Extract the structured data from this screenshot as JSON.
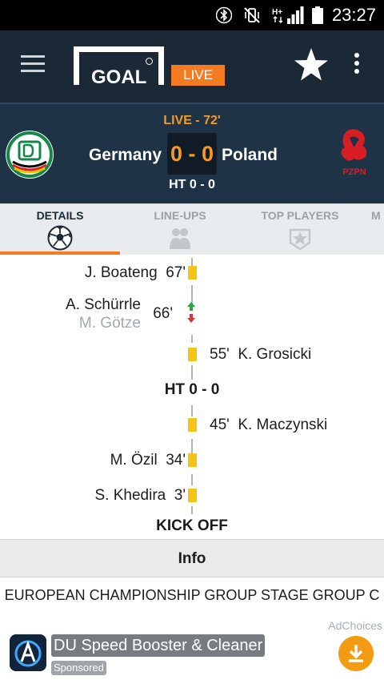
{
  "status_bar": {
    "time": "23:27",
    "icons": [
      "bluetooth-icon",
      "vibrate-icon",
      "hplus-network-icon",
      "signal-icon",
      "battery-icon"
    ]
  },
  "app_bar": {
    "logo_text": "GOAL",
    "live_badge": "LIVE",
    "icons": [
      "menu-icon",
      "star-icon",
      "more-vert-icon"
    ]
  },
  "match": {
    "status": "LIVE - 72'",
    "home_team": "Germany",
    "away_team": "Poland",
    "score": "0 - 0",
    "halftime": "HT 0 - 0",
    "away_crest_text": "PZPN"
  },
  "tabs": [
    {
      "label": "DETAILS",
      "icon": "soccer-ball-icon",
      "active": true
    },
    {
      "label": "LINE-UPS",
      "icon": "players-icon",
      "active": false
    },
    {
      "label": "TOP PLAYERS",
      "icon": "star-badge-icon",
      "active": false
    },
    {
      "label": "M",
      "icon": "",
      "active": false
    }
  ],
  "timeline": {
    "events": [
      {
        "side": "home",
        "type": "yellow-card",
        "player": "J. Boateng",
        "minute": "67'"
      },
      {
        "side": "home",
        "type": "substitution",
        "player_in": "A. Schürrle",
        "player_out": "M. Götze",
        "minute": "66'"
      },
      {
        "side": "away",
        "type": "yellow-card",
        "player": "K. Grosicki",
        "minute": "55'"
      },
      {
        "side": "away",
        "type": "yellow-card",
        "player": "K. Maczynski",
        "minute": "45'"
      },
      {
        "side": "home",
        "type": "yellow-card",
        "player": "M. Özil",
        "minute": "34'"
      },
      {
        "side": "home",
        "type": "yellow-card",
        "player": "S. Khedira",
        "minute": "3'"
      }
    ],
    "halftime_marker": "HT 0 - 0",
    "kickoff_marker": "KICK OFF"
  },
  "info": {
    "header": "Info",
    "competition": "EUROPEAN CHAMPIONSHIP GROUP STAGE GROUP C"
  },
  "ad": {
    "ad_choices": "AdChoices",
    "title": "DU Speed Booster & Cleaner",
    "sponsored": "Sponsored",
    "icons": [
      "app-icon",
      "download-icon"
    ]
  },
  "colors": {
    "app_bar": "#1b2936",
    "match_header": "#1f3347",
    "accent_orange": "#f47b20",
    "score_orange": "#f59a23",
    "yellow_card": "#f6c417"
  }
}
